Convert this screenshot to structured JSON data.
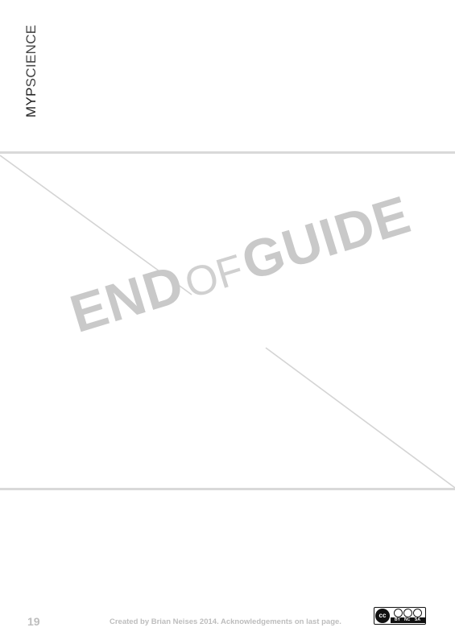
{
  "brand": {
    "part1": "MYP",
    "part2": "SCIENCE"
  },
  "banner": {
    "word1": "END",
    "word2": "OF",
    "word3": "GUIDE"
  },
  "footer": {
    "page_number": "19",
    "credit": "Created by Brian Neises 2014.  Acknowledgements on last page.",
    "license": {
      "cc": "cc",
      "by": "BY",
      "nc": "NC",
      "sa": "SA"
    }
  },
  "colors": {
    "rule": "#d9d9d9",
    "title": "#c9c9c9",
    "footer_text": "#bdbdbd"
  }
}
